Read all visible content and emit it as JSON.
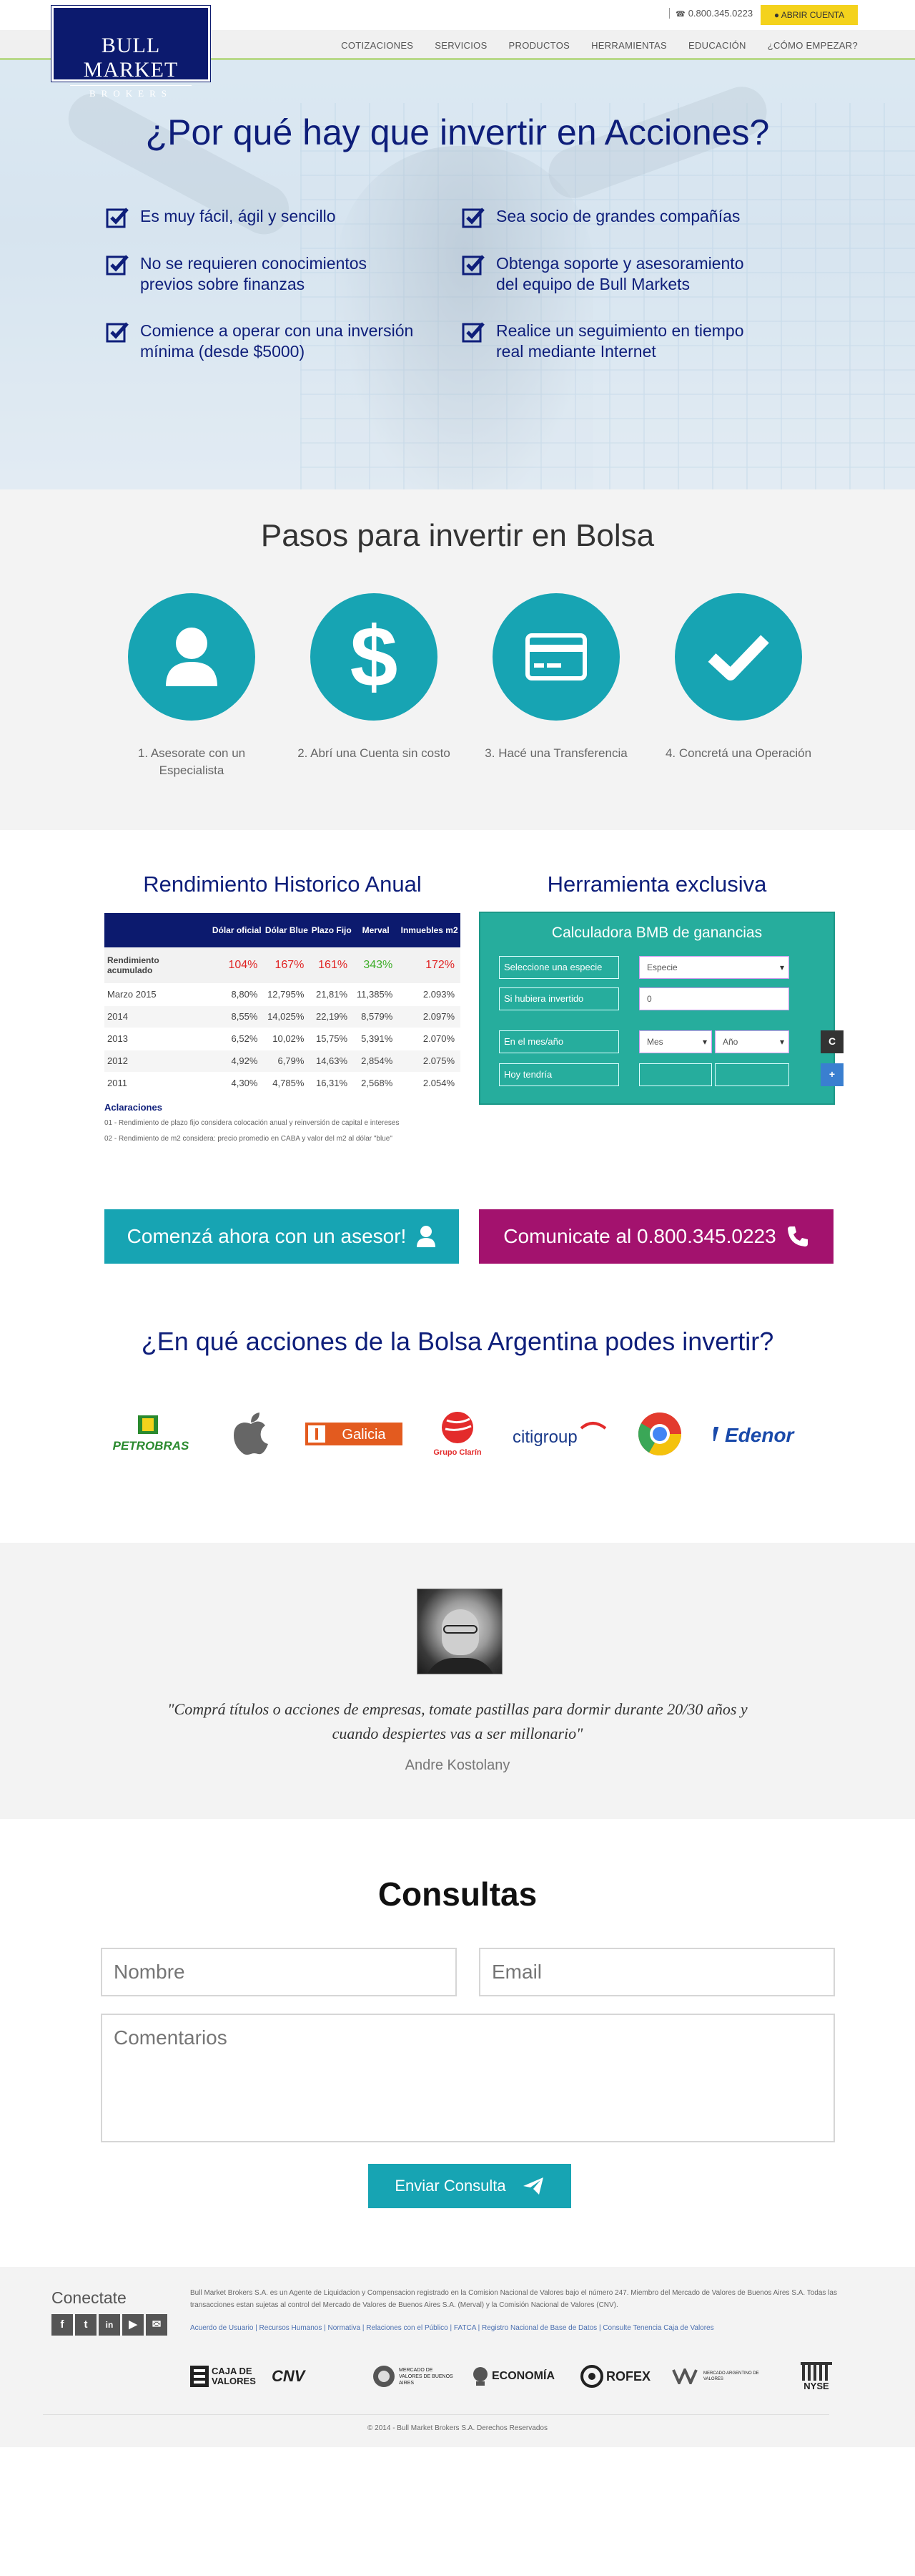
{
  "header": {
    "logo_line1": "BULL MARKET",
    "logo_line2": "BROKERS",
    "phone": "0.800.345.0223",
    "open_account": "ABRIR CUENTA",
    "nav": [
      "COTIZACIONES",
      "SERVICIOS",
      "PRODUCTOS",
      "HERRAMIENTAS",
      "EDUCACIÓN",
      "¿CÓMO EMPEZAR?"
    ]
  },
  "hero": {
    "title": "¿Por qué hay que invertir en Acciones?",
    "features": [
      "Es muy fácil, ágil y sencillo",
      "Sea socio de grandes compañías",
      "No se requieren conocimientos previos sobre finanzas",
      "Obtenga soporte y asesoramiento del equipo de Bull Markets",
      "Comience a operar con una inversión mínima (desde $5000)",
      "Realice un seguimiento en tiempo real mediante Internet"
    ]
  },
  "pasos": {
    "title": "Pasos para invertir en Bolsa",
    "steps": [
      {
        "label": "1. Asesorate con un Especialista",
        "icon": "user-icon"
      },
      {
        "label": "2. Abrí una Cuenta sin costo",
        "icon": "dollar-icon"
      },
      {
        "label": "3. Hacé una Transferencia",
        "icon": "credit-card-icon"
      },
      {
        "label": "4. Concretá una Operación",
        "icon": "check-icon"
      }
    ]
  },
  "rendimiento": {
    "title": "Rendimiento Historico Anual",
    "headers": [
      "",
      "Dólar oficial",
      "Dólar Blue",
      "Plazo Fijo",
      "Merval",
      "Inmuebles m2"
    ],
    "accum_label": "Rendimiento acumulado",
    "accum": [
      "104%",
      "167%",
      "161%",
      "343%",
      "172%"
    ],
    "rows": [
      [
        "Marzo 2015",
        "8,80%",
        "12,795%",
        "21,81%",
        "11,385%",
        "2.093%"
      ],
      [
        "2014",
        "8,55%",
        "14,025%",
        "22,19%",
        "8,579%",
        "2.097%"
      ],
      [
        "2013",
        "6,52%",
        "10,02%",
        "15,75%",
        "5,391%",
        "2.070%"
      ],
      [
        "2012",
        "4,92%",
        "6,79%",
        "14,63%",
        "2,854%",
        "2.075%"
      ],
      [
        "2011",
        "4,30%",
        "4,785%",
        "16,31%",
        "2,568%",
        "2.054%"
      ]
    ],
    "aclaraciones": "Aclaraciones",
    "notes": [
      "01 - Rendimiento de plazo fijo considera colocación anual y reinversión de capital e intereses",
      "02 - Rendimiento de m2 considera: precio promedio en CABA y valor del m2 al dólar \"blue\""
    ]
  },
  "calculadora": {
    "section_title": "Herramienta exclusiva",
    "title": "Calculadora BMB de ganancias",
    "especie_label": "Seleccione una especie",
    "especie_value": "Especie",
    "invertido_label": "Si hubiera invertido",
    "invertido_value": "0",
    "mes_label": "En el mes/año",
    "mes_value": "Mes",
    "anio_value": "Año",
    "calc_button": "C",
    "hoy_label": "Hoy tendría",
    "plus_button": "+"
  },
  "cta": {
    "asesor": "Comenzá ahora con un asesor!",
    "phone": "Comunicate al 0.800.345.0223"
  },
  "acciones": {
    "title": "¿En qué acciones de la Bolsa Argentina podes invertir?",
    "brands": [
      {
        "name": "PETROBRAS",
        "icon": "petrobras-logo"
      },
      {
        "name": "",
        "icon": "apple-logo"
      },
      {
        "name": "Galicia",
        "icon": "galicia-logo"
      },
      {
        "name": "Grupo Clarín",
        "icon": "clarin-logo"
      },
      {
        "name": "citigroup",
        "icon": "citigroup-logo"
      },
      {
        "name": "",
        "icon": "chrome-logo"
      },
      {
        "name": "Edenor",
        "icon": "edenor-logo"
      }
    ]
  },
  "quote": {
    "text": "\"Comprá títulos o acciones de empresas, tomate pastillas para dormir durante 20/30 años y cuando despiertes vas a ser millonario\"",
    "author": "Andre Kostolany"
  },
  "consultas": {
    "title": "Consultas",
    "nombre_placeholder": "Nombre",
    "email_placeholder": "Email",
    "comentarios_placeholder": "Comentarios",
    "send": "Enviar Consulta"
  },
  "footer": {
    "conectate": "Conectate",
    "social": [
      "f",
      "t",
      "in",
      "yt",
      "mail"
    ],
    "legal": "Bull Market Brokers S.A. es un Agente de Liquidacion y Compensacion registrado en la Comision Nacional de Valores bajo el número 247. Miembro del Mercado de Valores de Buenos Aires S.A. Todas las transacciones estan sujetas al control del Mercado de Valores de Buenos Aires S.A. (Merval) y la Comisión Nacional de Valores (CNV).",
    "links": "Acuerdo de Usuario | Recursos Humanos | Normativa | Relaciones con el Público | FATCA | Registro Nacional de Base de Datos | Consulte Tenencia Caja de Valores",
    "regulators": [
      "CAJA DE VALORES",
      "CNV",
      "MERCADO DE VALORES DE BUENOS AIRES",
      "ECONOMÍA",
      "ROFEX",
      "MERCADO ARGENTINO DE VALORES",
      "NYSE"
    ],
    "copyright": "© 2014 - Bull Market Brokers S.A. Derechos Reservados"
  },
  "colors": {
    "navy": "#0e1e7a",
    "teal": "#17a4b3",
    "magenta": "#a3126e",
    "yellow": "#f4d21c",
    "calc_green": "#26ad9d"
  }
}
